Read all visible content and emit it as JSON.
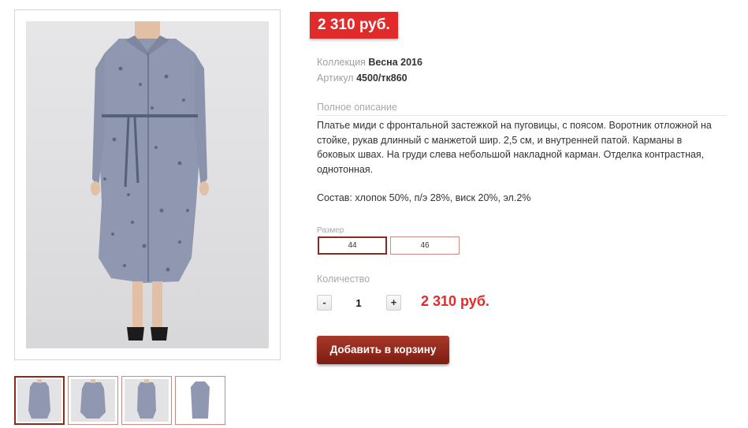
{
  "gallery": {
    "main_image": "dress-photo",
    "thumbnails": [
      {
        "name": "thumb-1",
        "active": true
      },
      {
        "name": "thumb-2",
        "active": false
      },
      {
        "name": "thumb-3",
        "active": false
      },
      {
        "name": "thumb-4",
        "active": false
      }
    ]
  },
  "product": {
    "price_badge": "2 310 руб.",
    "collection_label": "Коллекция",
    "collection_value": "Весна 2016",
    "article_label": "Артикул",
    "article_value": "4500/тк860",
    "description_title": "Полное описание",
    "description_text": "Платье миди с фронтальной застежкой на пуговицы, с поясом. Воротник отложной на стойке, рукав длинный с манжетой шир. 2,5 см, и внутренней патой. Карманы в боковых швах. На груди слева небольшой накладной карман. Отделка контрастная, однотонная.",
    "composition": "Состав: хлопок 50%, п/э 28%, виск 20%, эл.2%"
  },
  "size": {
    "title": "Размер",
    "options": [
      "44",
      "46"
    ],
    "selected": "44"
  },
  "quantity": {
    "title": "Количество",
    "minus": "-",
    "plus": "+",
    "value": "1",
    "total": "2 310 руб."
  },
  "cart": {
    "button_label": "Добавить в корзину"
  },
  "colors": {
    "price_red": "#e12b2b",
    "accent_dark_red": "#8b2a1a",
    "dress_blue_grey": "#8f98b0"
  }
}
